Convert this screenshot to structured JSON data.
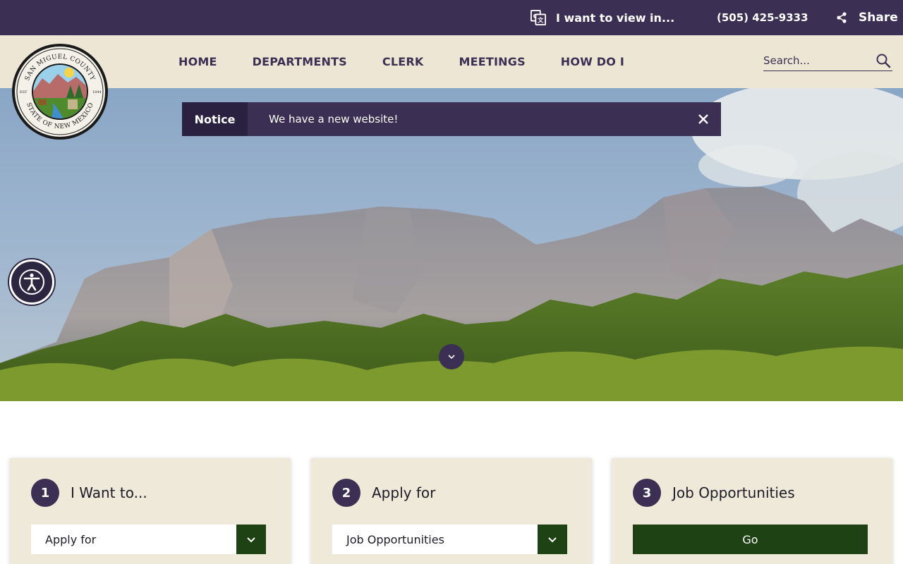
{
  "topbar": {
    "translate_label": "I want to view in...",
    "phone": "(505) 425-9333",
    "share_label": "Share",
    "translate_icon": "translate-icon",
    "share_icon": "share-icon"
  },
  "header": {
    "logo_text_top": "SAN MIGUEL COUNTY",
    "logo_text_bottom": "STATE OF NEW MEXICO",
    "logo_est": "EST",
    "logo_year": "1844",
    "nav": [
      "HOME",
      "DEPARTMENTS",
      "CLERK",
      "MEETINGS",
      "HOW DO I"
    ],
    "search_placeholder": "Search...",
    "search_icon": "search-icon"
  },
  "notice": {
    "label": "Notice",
    "text": "We have a new website!",
    "close_icon": "close-icon"
  },
  "hero": {
    "accessibility_icon": "accessibility-icon",
    "scroll_icon": "chevron-down-icon"
  },
  "cards": [
    {
      "number": "1",
      "title": "I Want to...",
      "select_value": "Apply for"
    },
    {
      "number": "2",
      "title": "Apply for",
      "select_value": "Job Opportunities"
    },
    {
      "number": "3",
      "title": "Job Opportunities",
      "button_label": "Go"
    }
  ],
  "colors": {
    "primary": "#3b3054",
    "header_bg": "#ede6d4",
    "card_bg": "#efe9d9",
    "accent_green": "#1e4214"
  }
}
